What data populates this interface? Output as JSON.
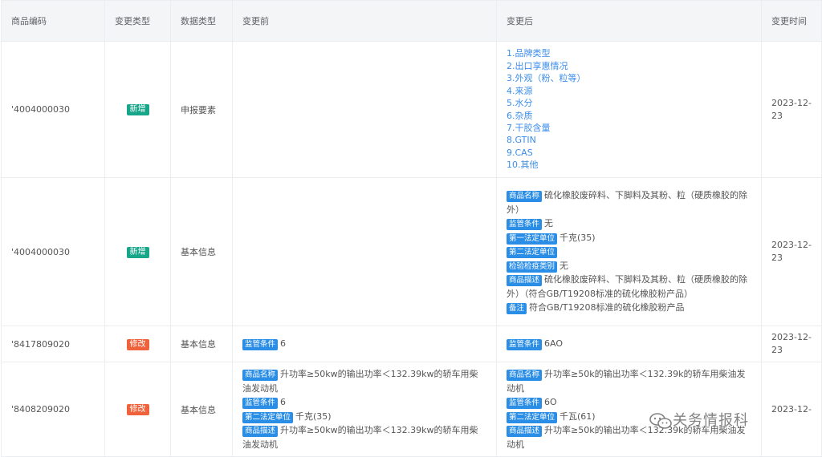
{
  "headers": [
    "商品编码",
    "变更类型",
    "数据类型",
    "变更前",
    "变更后",
    "变更时间"
  ],
  "row1": {
    "code": "'4004000030",
    "type": "新增",
    "data_type": "申报要素",
    "after": [
      "1.品牌类型",
      "2.出口享惠情况",
      "3.外观（粉、粒等）",
      "4.来源",
      "5.水分",
      "6.杂质",
      "7.干胶含量",
      "8.GTIN",
      "9.CAS",
      "10.其他"
    ],
    "time": "2023-12-23"
  },
  "row2": {
    "code": "'4004000030",
    "type": "新增",
    "data_type": "基本信息",
    "after": [
      {
        "label": "商品名称",
        "value": "硫化橡胶废碎料、下脚料及其粉、粒（硬质橡胶的除外）"
      },
      {
        "label": "监管条件",
        "value": "无"
      },
      {
        "label": "第一法定单位",
        "value": "千克(35)"
      },
      {
        "label": "第二法定单位",
        "value": ""
      },
      {
        "label": "检验检疫类别",
        "value": "无"
      },
      {
        "label": "商品描述",
        "value": "硫化橡胶废碎料、下脚料及其粉、粒（硬质橡胶的除外）（符合GB/T19208标准的硫化橡胶粉产品）"
      },
      {
        "label": "备注",
        "value": "符合GB/T19208标准的硫化橡胶粉产品"
      }
    ],
    "time": "2023-12-23"
  },
  "row3": {
    "code": "'8417809020",
    "type": "修改",
    "data_type": "基本信息",
    "before": [
      {
        "label": "监管条件",
        "value": "6"
      }
    ],
    "after": [
      {
        "label": "监管条件",
        "value": "6AO"
      }
    ],
    "time": "2023-12-23"
  },
  "row4": {
    "code": "'8408209020",
    "type": "修改",
    "data_type": "基本信息",
    "before": [
      {
        "label": "商品名称",
        "value": "升功率≥50kw的输出功率＜132.39kw的轿车用柴油发动机"
      },
      {
        "label": "监管条件",
        "value": "6"
      },
      {
        "label": "第二法定单位",
        "value": "千克(35)"
      },
      {
        "label": "商品描述",
        "value": "升功率≥50kw的输出功率＜132.39kw的轿车用柴油发动机"
      }
    ],
    "after": [
      {
        "label": "商品名称",
        "value": "升功率≥50k的输出功率＜132.39k的轿车用柴油发动机"
      },
      {
        "label": "监管条件",
        "value": "6O"
      },
      {
        "label": "第二法定单位",
        "value": "千瓦(61)"
      },
      {
        "label": "商品描述",
        "value": "升功率≥50k的输出功率＜132.39k的轿车用柴油发动机"
      }
    ],
    "time": "2023-12-"
  },
  "watermark": "关务情报科",
  "colors": {
    "tag_new": "#17a689",
    "tag_modify": "#f0623b",
    "label_bg": "#2b8ee6",
    "link_text": "#3b8ee9",
    "header_bg": "#f4f5f7"
  }
}
